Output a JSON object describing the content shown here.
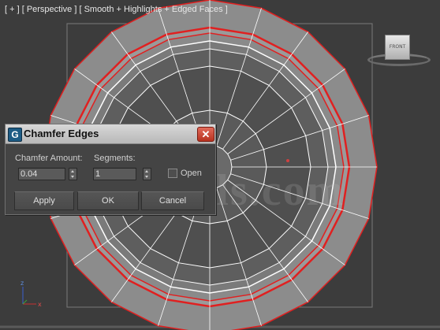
{
  "viewport": {
    "label": "[ + ] [ Perspective ] [ Smooth + Highlights + Edged Faces ]",
    "watermark": "Tutorials.com",
    "background_color": "#3c3c3c",
    "selection_color": "#e02020",
    "wire_color": "#ffffff",
    "grid_color": "#7a7a7a"
  },
  "viewcube": {
    "label": "FRONT",
    "icon": "viewcube-icon"
  },
  "axis_gizmo": {
    "z_label": "z",
    "x_label": "x"
  },
  "dialog": {
    "title": "Chamfer Edges",
    "icon": "app-logo-icon",
    "icon_glyph": "G",
    "close_glyph": "✕",
    "chamfer_amount": {
      "label": "Chamfer Amount:",
      "value": "0.04"
    },
    "segments": {
      "label": "Segments:",
      "value": "1"
    },
    "open": {
      "label": "Open",
      "checked": false
    },
    "buttons": {
      "apply": "Apply",
      "ok": "OK",
      "cancel": "Cancel"
    }
  }
}
